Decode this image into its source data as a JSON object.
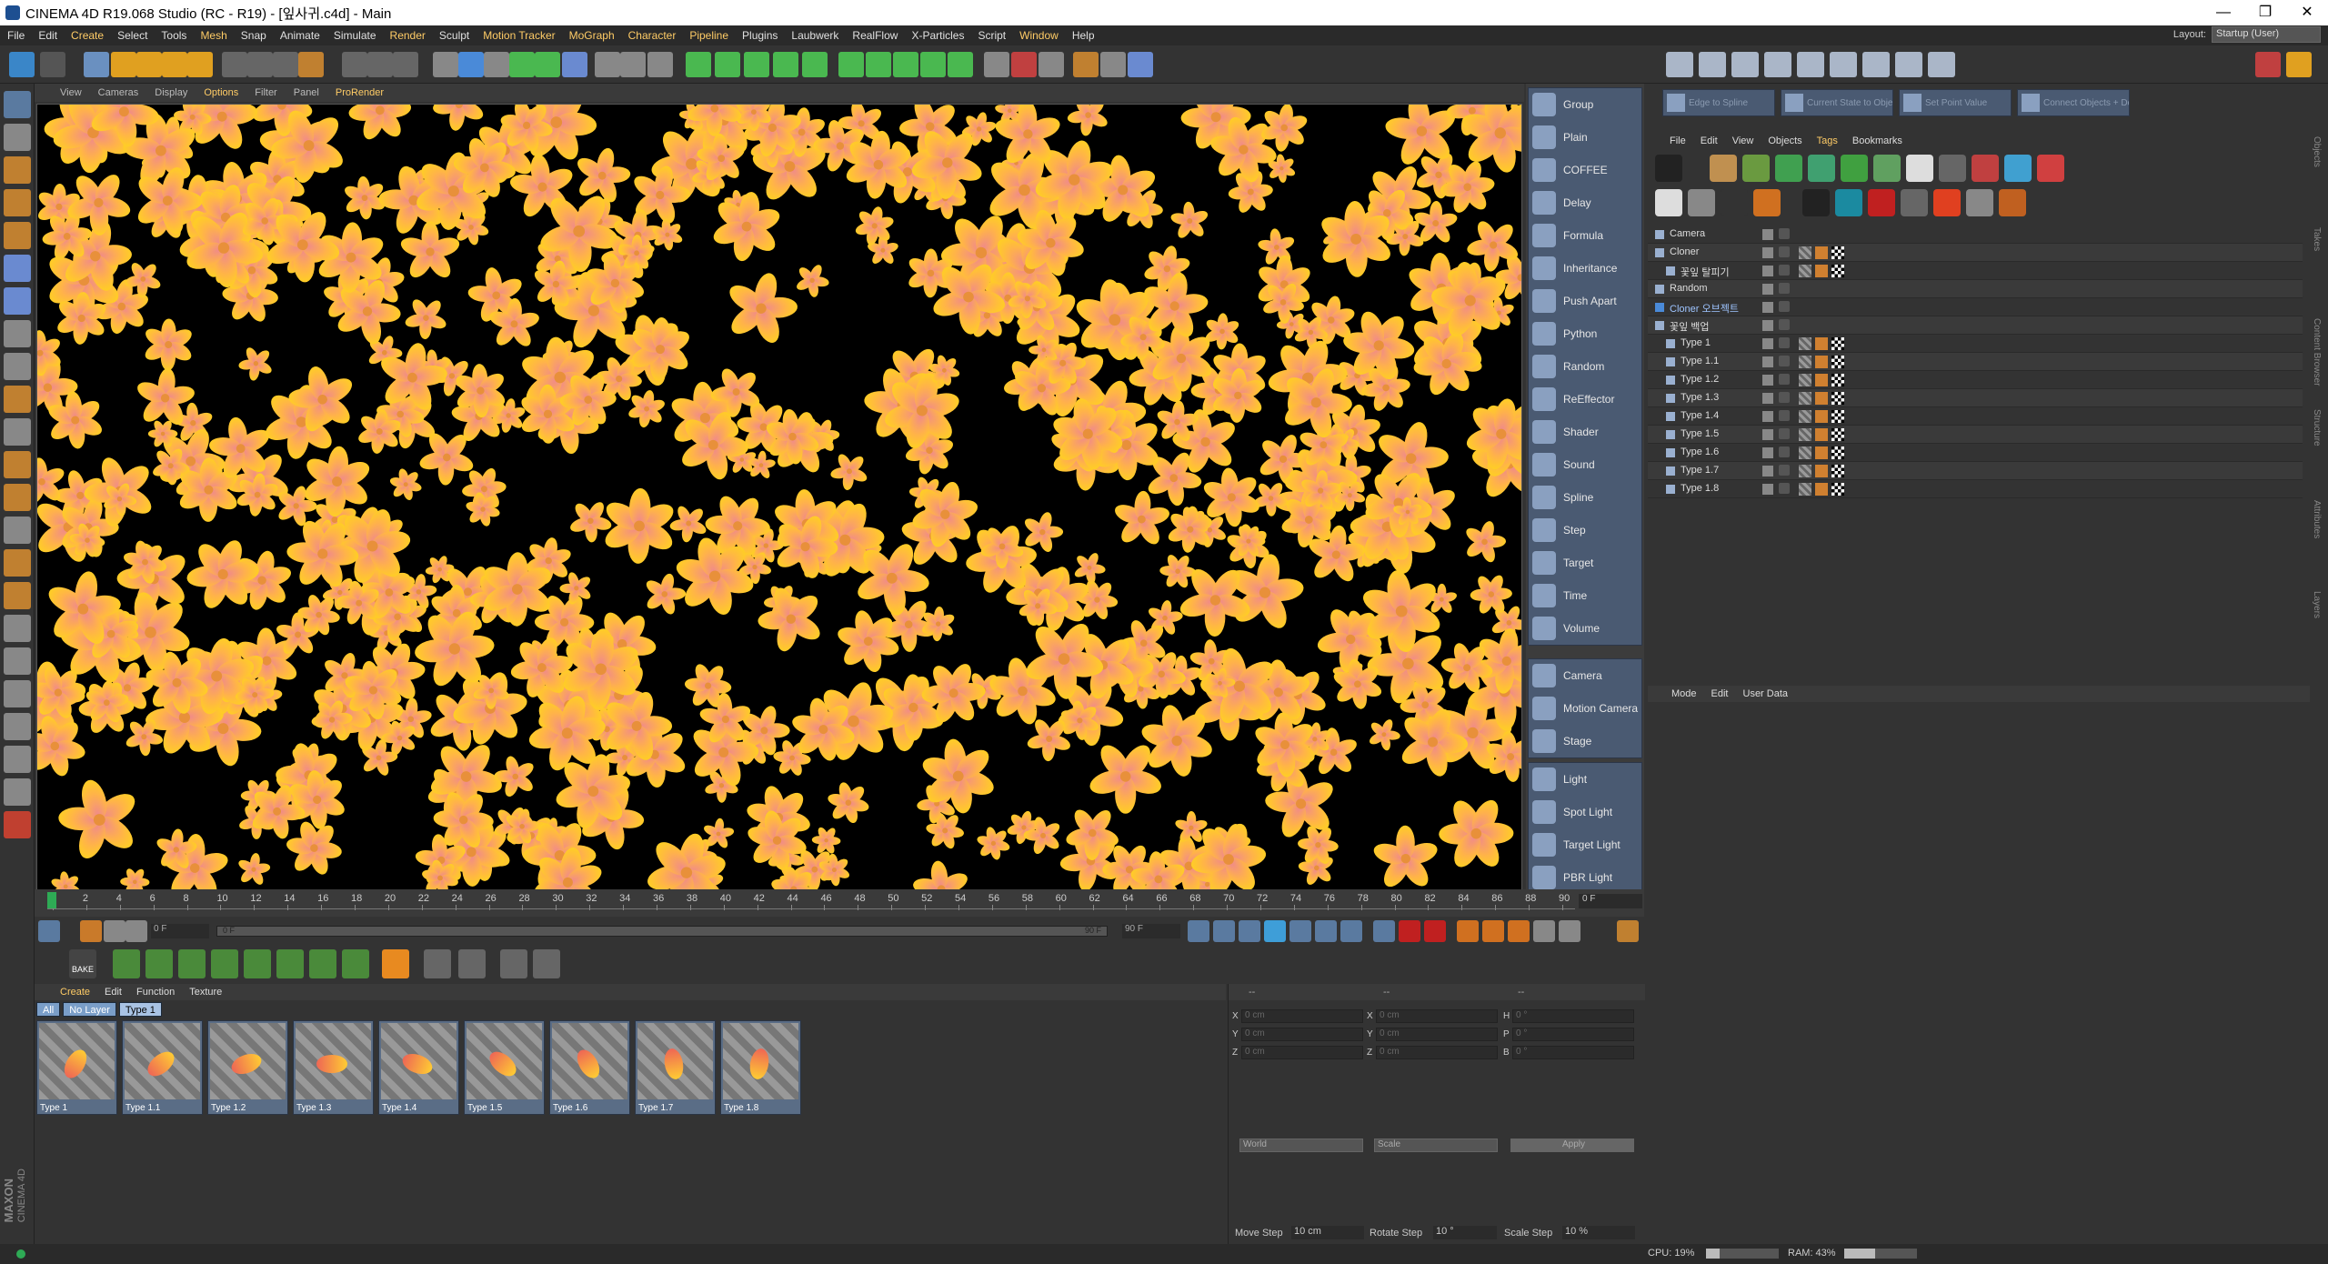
{
  "window": {
    "title": "CINEMA 4D R19.068 Studio (RC - R19) - [잎사귀.c4d] - Main",
    "minimize": "—",
    "restore": "❐",
    "close": "✕"
  },
  "menu": {
    "items": [
      "File",
      "Edit",
      "Create",
      "Select",
      "Tools",
      "Mesh",
      "Snap",
      "Animate",
      "Simulate",
      "Render",
      "Sculpt",
      "Motion Tracker",
      "MoGraph",
      "Character",
      "Pipeline",
      "Plugins",
      "Laubwerk",
      "RealFlow",
      "X-Particles",
      "Script",
      "Window",
      "Help"
    ],
    "highlighted": [
      "Create",
      "Mesh",
      "Render",
      "Motion Tracker",
      "MoGraph",
      "Character",
      "Pipeline",
      "Window"
    ],
    "layout_label": "Layout:",
    "layout_value": "Startup (User)"
  },
  "viewport_menu": {
    "items": [
      "View",
      "Cameras",
      "Display",
      "Options",
      "Filter",
      "Panel",
      "ProRender"
    ],
    "highlighted": [
      "Options",
      "ProRender"
    ]
  },
  "mograph_effectors": [
    {
      "label": "Group",
      "icon": "group-icon"
    },
    {
      "label": "Plain",
      "icon": "plain-effector-icon"
    },
    {
      "label": "COFFEE",
      "icon": "coffee-effector-icon"
    },
    {
      "label": "Delay",
      "icon": "delay-effector-icon"
    },
    {
      "label": "Formula",
      "icon": "formula-effector-icon"
    },
    {
      "label": "Inheritance",
      "icon": "inheritance-effector-icon"
    },
    {
      "label": "Push Apart",
      "icon": "push-apart-effector-icon"
    },
    {
      "label": "Python",
      "icon": "python-effector-icon"
    },
    {
      "label": "Random",
      "icon": "random-effector-icon"
    },
    {
      "label": "ReEffector",
      "icon": "reeffector-icon"
    },
    {
      "label": "Shader",
      "icon": "shader-effector-icon"
    },
    {
      "label": "Sound",
      "icon": "sound-effector-icon"
    },
    {
      "label": "Spline",
      "icon": "spline-effector-icon"
    },
    {
      "label": "Step",
      "icon": "step-effector-icon"
    },
    {
      "label": "Target",
      "icon": "target-effector-icon"
    },
    {
      "label": "Time",
      "icon": "time-effector-icon"
    },
    {
      "label": "Volume",
      "icon": "volume-effector-icon"
    }
  ],
  "cameras": [
    {
      "label": "Camera",
      "icon": "camera-icon"
    },
    {
      "label": "Motion Camera",
      "icon": "motion-camera-icon"
    },
    {
      "label": "Stage",
      "icon": "stage-icon"
    }
  ],
  "lights": [
    {
      "label": "Light",
      "icon": "light-icon"
    },
    {
      "label": "Spot Light",
      "icon": "spot-light-icon"
    },
    {
      "label": "Target Light",
      "icon": "target-light-icon"
    },
    {
      "label": "PBR Light",
      "icon": "pbr-light-icon"
    }
  ],
  "timeline": {
    "ticks": [
      "0",
      "2",
      "4",
      "6",
      "8",
      "10",
      "12",
      "14",
      "16",
      "18",
      "20",
      "22",
      "24",
      "26",
      "28",
      "30",
      "32",
      "34",
      "36",
      "38",
      "40",
      "42",
      "44",
      "46",
      "48",
      "50",
      "52",
      "54",
      "56",
      "58",
      "60",
      "62",
      "64",
      "66",
      "68",
      "70",
      "72",
      "74",
      "76",
      "78",
      "80",
      "82",
      "84",
      "86",
      "88",
      "90"
    ],
    "current_frame": "0 F"
  },
  "transport": {
    "start_field": "0 F",
    "min_field": "0 F",
    "max_field": "90 F",
    "end_field": "90 F"
  },
  "keys": {
    "bake_label": "BAKE"
  },
  "materials_menu": {
    "items": [
      "Create",
      "Edit",
      "Function",
      "Texture"
    ],
    "highlighted": [
      "Create"
    ]
  },
  "material_filters": [
    "All",
    "No Layer",
    "Type 1"
  ],
  "materials": [
    "Type 1",
    "Type 1.1",
    "Type 1.2",
    "Type 1.3",
    "Type 1.4",
    "Type 1.5",
    "Type 1.6",
    "Type 1.7",
    "Type 1.8"
  ],
  "coordinates": {
    "header": [
      "--",
      "--",
      "--"
    ],
    "rows": [
      {
        "a": "X",
        "av": "0 cm",
        "b": "X",
        "bv": "0 cm",
        "c": "H",
        "cv": "0 °"
      },
      {
        "a": "Y",
        "av": "0 cm",
        "b": "Y",
        "bv": "0 cm",
        "c": "P",
        "cv": "0 °"
      },
      {
        "a": "Z",
        "av": "0 cm",
        "b": "Z",
        "bv": "0 cm",
        "c": "B",
        "cv": "0 °"
      }
    ],
    "world": "World",
    "scale": "Scale",
    "apply": "Apply"
  },
  "object_tools": [
    "Edge to Spline",
    "Current State to Object",
    "Set Point Value",
    "Connect Objects + Delete"
  ],
  "object_menu": {
    "items": [
      "File",
      "Edit",
      "View",
      "Objects",
      "Tags",
      "Bookmarks"
    ],
    "highlighted": [
      "Tags"
    ]
  },
  "objects": [
    {
      "name": "Camera",
      "indent": 0,
      "blue": false
    },
    {
      "name": "Cloner",
      "indent": 0,
      "blue": false
    },
    {
      "name": "꽃잎 탈피기",
      "indent": 1,
      "blue": false
    },
    {
      "name": "Random",
      "indent": 0,
      "blue": false
    },
    {
      "name": "Cloner 오브젝트",
      "indent": 0,
      "blue": true
    },
    {
      "name": "꽃잎 백업",
      "indent": 0,
      "blue": false
    },
    {
      "name": "Type 1",
      "indent": 1,
      "blue": false
    },
    {
      "name": "Type 1.1",
      "indent": 1,
      "blue": false
    },
    {
      "name": "Type 1.2",
      "indent": 1,
      "blue": false
    },
    {
      "name": "Type 1.3",
      "indent": 1,
      "blue": false
    },
    {
      "name": "Type 1.4",
      "indent": 1,
      "blue": false
    },
    {
      "name": "Type 1.5",
      "indent": 1,
      "blue": false
    },
    {
      "name": "Type 1.6",
      "indent": 1,
      "blue": false
    },
    {
      "name": "Type 1.7",
      "indent": 1,
      "blue": false
    },
    {
      "name": "Type 1.8",
      "indent": 1,
      "blue": false
    }
  ],
  "attributes_menu": [
    "Mode",
    "Edit",
    "User Data"
  ],
  "right_tabs": [
    "Objects",
    "Takes",
    "Content Browser",
    "Structure",
    "Attributes",
    "Layers"
  ],
  "steps": {
    "move_label": "Move Step",
    "move_value": "10 cm",
    "rotate_label": "Rotate Step",
    "rotate_value": "10 °",
    "scale_label": "Scale Step",
    "scale_value": "10 %"
  },
  "status": {
    "cpu": "CPU: 19%",
    "ram": "RAM: 43%"
  },
  "logo": {
    "brand": "MAXON",
    "product": "CINEMA 4D"
  },
  "colors": {
    "accent": "#ffcc66",
    "mograph_panel": "#4a5a72",
    "timeline_cursor": "#2eaa55",
    "flower_yellow": "#ffd21f",
    "flower_pink": "#f08a8a"
  }
}
